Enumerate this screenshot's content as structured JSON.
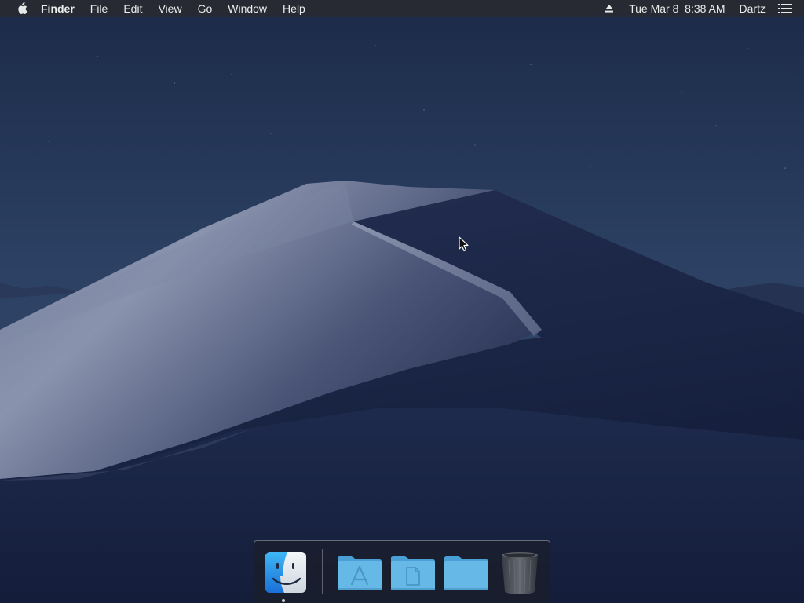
{
  "menubar": {
    "apple_icon": "apple-logo-icon",
    "app_name": "Finder",
    "menus": [
      "File",
      "Edit",
      "View",
      "Go",
      "Window",
      "Help"
    ],
    "eject_icon": "eject-icon",
    "datetime": "Tue Mar 8  8:38 AM",
    "user": "Dartz",
    "notification_icon": "notification-center-icon"
  },
  "dock": {
    "items": [
      {
        "icon": "finder-icon",
        "running": true
      },
      {
        "icon": "applications-folder-icon",
        "running": false
      },
      {
        "icon": "documents-folder-icon",
        "running": false
      },
      {
        "icon": "downloads-folder-icon",
        "running": false
      },
      {
        "icon": "trash-icon",
        "running": false
      }
    ]
  },
  "colors": {
    "menubar_bg": "#2a2c32",
    "sky": "#1a2746",
    "folder_blue": "#5fb3e3"
  }
}
